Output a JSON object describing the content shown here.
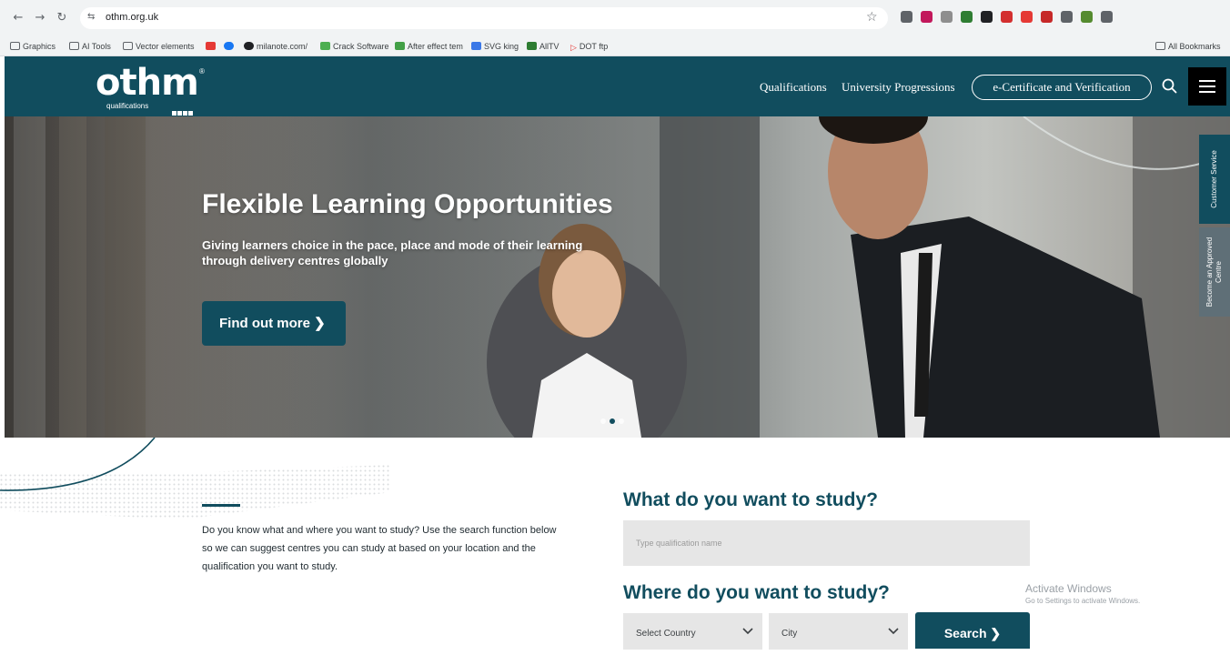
{
  "browser": {
    "url": "othm.org.uk",
    "bookmarks": [
      {
        "label": "Graphics",
        "color": "#5f6368"
      },
      {
        "label": "AI Tools",
        "color": "#5f6368"
      },
      {
        "label": "Vector elements",
        "color": "#5f6368"
      },
      {
        "label": "",
        "color": "#e53935"
      },
      {
        "label": "",
        "color": "#1877f2"
      },
      {
        "label": "milanote.com/",
        "color": "#202124"
      },
      {
        "label": "Crack Software",
        "color": "#4caf50"
      },
      {
        "label": "After effect tem",
        "color": "#43a047"
      },
      {
        "label": "SVG king",
        "color": "#3b78e7"
      },
      {
        "label": "AllTV",
        "color": "#2e7d32"
      },
      {
        "label": "DOT ftp",
        "color": "#e53935"
      }
    ],
    "all_bookmarks": "All Bookmarks",
    "extension_colors": [
      "#5f6368",
      "#c2185b",
      "#8e8e8e",
      "#2e7d32",
      "#202124",
      "#d32f2f",
      "#e53935",
      "#c62828",
      "#5f6368",
      "#558b2f",
      "#5f6368"
    ]
  },
  "header": {
    "logo_text": "othm",
    "logo_reg": "®",
    "logo_sub": "qualifications",
    "nav_qualifications": "Qualifications",
    "nav_university": "University Progressions",
    "nav_certificate": "e-Certificate and Verification"
  },
  "hero": {
    "title": "Flexible Learning Opportunities",
    "subtitle": "Giving learners choice in the pace, place and mode of their learning through delivery centres globally",
    "button": "Find out more ❯",
    "side_tab_1": "Customer Service",
    "side_tab_2": "Become an Approved Centre"
  },
  "study": {
    "intro": "Do you know what and where you want to study? Use the search function below so we can suggest centres you can study at based on your location and the qualification you want to study.",
    "what_heading": "What do you want to study?",
    "qual_placeholder": "Type qualification name",
    "where_heading": "Where do you want to study?",
    "country": "Select Country",
    "city": "City",
    "search_button": "Search ❯"
  },
  "windows": {
    "line1": "Activate Windows",
    "line2": "Go to Settings to activate Windows."
  }
}
